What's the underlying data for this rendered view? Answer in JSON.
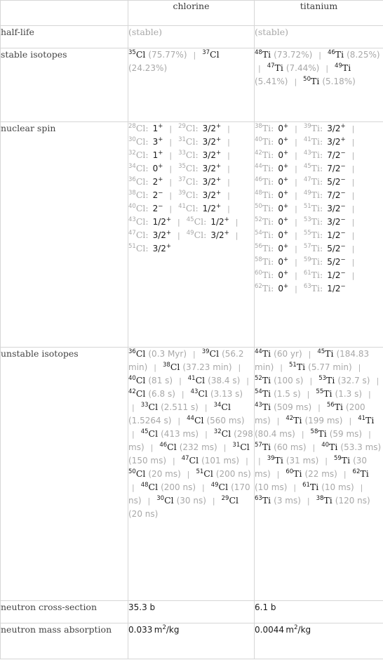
{
  "columns": [
    "",
    "chlorine",
    "titanium"
  ],
  "rows": {
    "half_life": {
      "label": "half-life",
      "chlorine": "(stable)",
      "titanium": "(stable)"
    },
    "stable_isotopes": {
      "label": "stable isotopes",
      "chlorine": [
        {
          "mass": "35",
          "symbol": "Cl",
          "value": "(75.77%)"
        },
        {
          "mass": "37",
          "symbol": "Cl",
          "value": "(24.23%)"
        }
      ],
      "titanium": [
        {
          "mass": "48",
          "symbol": "Ti",
          "value": "(73.72%)"
        },
        {
          "mass": "46",
          "symbol": "Ti",
          "value": "(8.25%)"
        },
        {
          "mass": "47",
          "symbol": "Ti",
          "value": "(7.44%)"
        },
        {
          "mass": "49",
          "symbol": "Ti",
          "value": "(5.41%)"
        },
        {
          "mass": "50",
          "symbol": "Ti",
          "value": "(5.18%)"
        }
      ]
    },
    "nuclear_spin": {
      "label": "nuclear spin",
      "chlorine": [
        {
          "mass": "28",
          "symbol": "Cl:",
          "spin": "1",
          "parity": "+"
        },
        {
          "mass": "29",
          "symbol": "Cl:",
          "spin": "3/2",
          "parity": "+"
        },
        {
          "mass": "30",
          "symbol": "Cl:",
          "spin": "3",
          "parity": "+"
        },
        {
          "mass": "31",
          "symbol": "Cl:",
          "spin": "3/2",
          "parity": "+"
        },
        {
          "mass": "32",
          "symbol": "Cl:",
          "spin": "1",
          "parity": "+"
        },
        {
          "mass": "33",
          "symbol": "Cl:",
          "spin": "3/2",
          "parity": "+"
        },
        {
          "mass": "34",
          "symbol": "Cl:",
          "spin": "0",
          "parity": "+"
        },
        {
          "mass": "35",
          "symbol": "Cl:",
          "spin": "3/2",
          "parity": "+"
        },
        {
          "mass": "36",
          "symbol": "Cl:",
          "spin": "2",
          "parity": "+"
        },
        {
          "mass": "37",
          "symbol": "Cl:",
          "spin": "3/2",
          "parity": "+"
        },
        {
          "mass": "38",
          "symbol": "Cl:",
          "spin": "2",
          "parity": "−"
        },
        {
          "mass": "39",
          "symbol": "Cl:",
          "spin": "3/2",
          "parity": "+"
        },
        {
          "mass": "40",
          "symbol": "Cl:",
          "spin": "2",
          "parity": "−"
        },
        {
          "mass": "41",
          "symbol": "Cl:",
          "spin": "1/2",
          "parity": "+"
        },
        {
          "mass": "43",
          "symbol": "Cl:",
          "spin": "1/2",
          "parity": "+"
        },
        {
          "mass": "45",
          "symbol": "Cl:",
          "spin": "1/2",
          "parity": "+"
        },
        {
          "mass": "47",
          "symbol": "Cl:",
          "spin": "3/2",
          "parity": "+"
        },
        {
          "mass": "49",
          "symbol": "Cl:",
          "spin": "3/2",
          "parity": "+"
        },
        {
          "mass": "51",
          "symbol": "Cl:",
          "spin": "3/2",
          "parity": "+"
        }
      ],
      "titanium": [
        {
          "mass": "38",
          "symbol": "Ti:",
          "spin": "0",
          "parity": "+"
        },
        {
          "mass": "39",
          "symbol": "Ti:",
          "spin": "3/2",
          "parity": "+"
        },
        {
          "mass": "40",
          "symbol": "Ti:",
          "spin": "0",
          "parity": "+"
        },
        {
          "mass": "41",
          "symbol": "Ti:",
          "spin": "3/2",
          "parity": "+"
        },
        {
          "mass": "42",
          "symbol": "Ti:",
          "spin": "0",
          "parity": "+"
        },
        {
          "mass": "43",
          "symbol": "Ti:",
          "spin": "7/2",
          "parity": "−"
        },
        {
          "mass": "44",
          "symbol": "Ti:",
          "spin": "0",
          "parity": "+"
        },
        {
          "mass": "45",
          "symbol": "Ti:",
          "spin": "7/2",
          "parity": "−"
        },
        {
          "mass": "46",
          "symbol": "Ti:",
          "spin": "0",
          "parity": "+"
        },
        {
          "mass": "47",
          "symbol": "Ti:",
          "spin": "5/2",
          "parity": "−"
        },
        {
          "mass": "48",
          "symbol": "Ti:",
          "spin": "0",
          "parity": "+"
        },
        {
          "mass": "49",
          "symbol": "Ti:",
          "spin": "7/2",
          "parity": "−"
        },
        {
          "mass": "50",
          "symbol": "Ti:",
          "spin": "0",
          "parity": "+"
        },
        {
          "mass": "51",
          "symbol": "Ti:",
          "spin": "3/2",
          "parity": "−"
        },
        {
          "mass": "52",
          "symbol": "Ti:",
          "spin": "0",
          "parity": "+"
        },
        {
          "mass": "53",
          "symbol": "Ti:",
          "spin": "3/2",
          "parity": "−"
        },
        {
          "mass": "54",
          "symbol": "Ti:",
          "spin": "0",
          "parity": "+"
        },
        {
          "mass": "55",
          "symbol": "Ti:",
          "spin": "1/2",
          "parity": "−"
        },
        {
          "mass": "56",
          "symbol": "Ti:",
          "spin": "0",
          "parity": "+"
        },
        {
          "mass": "57",
          "symbol": "Ti:",
          "spin": "5/2",
          "parity": "−"
        },
        {
          "mass": "58",
          "symbol": "Ti:",
          "spin": "0",
          "parity": "+"
        },
        {
          "mass": "59",
          "symbol": "Ti:",
          "spin": "5/2",
          "parity": "−"
        },
        {
          "mass": "60",
          "symbol": "Ti:",
          "spin": "0",
          "parity": "+"
        },
        {
          "mass": "61",
          "symbol": "Ti:",
          "spin": "1/2",
          "parity": "−"
        },
        {
          "mass": "62",
          "symbol": "Ti:",
          "spin": "0",
          "parity": "+"
        },
        {
          "mass": "63",
          "symbol": "Ti:",
          "spin": "1/2",
          "parity": "−"
        }
      ]
    },
    "unstable_isotopes": {
      "label": "unstable isotopes",
      "chlorine": [
        {
          "mass": "36",
          "symbol": "Cl",
          "value": "(0.3 Myr)"
        },
        {
          "mass": "39",
          "symbol": "Cl",
          "value": "(56.2 min)"
        },
        {
          "mass": "38",
          "symbol": "Cl",
          "value": "(37.23 min)"
        },
        {
          "mass": "40",
          "symbol": "Cl",
          "value": "(81 s)"
        },
        {
          "mass": "41",
          "symbol": "Cl",
          "value": "(38.4 s)"
        },
        {
          "mass": "42",
          "symbol": "Cl",
          "value": "(6.8 s)"
        },
        {
          "mass": "43",
          "symbol": "Cl",
          "value": "(3.13 s)"
        },
        {
          "mass": "33",
          "symbol": "Cl",
          "value": "(2.511 s)"
        },
        {
          "mass": "34",
          "symbol": "Cl",
          "value": "(1.5264 s)"
        },
        {
          "mass": "44",
          "symbol": "Cl",
          "value": "(560 ms)"
        },
        {
          "mass": "45",
          "symbol": "Cl",
          "value": "(413 ms)"
        },
        {
          "mass": "32",
          "symbol": "Cl",
          "value": "(298 ms)"
        },
        {
          "mass": "46",
          "symbol": "Cl",
          "value": "(232 ms)"
        },
        {
          "mass": "31",
          "symbol": "Cl",
          "value": "(150 ms)"
        },
        {
          "mass": "47",
          "symbol": "Cl",
          "value": "(101 ms)"
        },
        {
          "mass": "50",
          "symbol": "Cl",
          "value": "(20 ms)"
        },
        {
          "mass": "51",
          "symbol": "Cl",
          "value": "(200 ns)"
        },
        {
          "mass": "48",
          "symbol": "Cl",
          "value": "(200 ns)"
        },
        {
          "mass": "49",
          "symbol": "Cl",
          "value": "(170 ns)"
        },
        {
          "mass": "30",
          "symbol": "Cl",
          "value": "(30 ns)"
        },
        {
          "mass": "29",
          "symbol": "Cl",
          "value": "(20 ns)"
        }
      ],
      "titanium": [
        {
          "mass": "44",
          "symbol": "Ti",
          "value": "(60 yr)"
        },
        {
          "mass": "45",
          "symbol": "Ti",
          "value": "(184.83 min)"
        },
        {
          "mass": "51",
          "symbol": "Ti",
          "value": "(5.77 min)"
        },
        {
          "mass": "52",
          "symbol": "Ti",
          "value": "(100 s)"
        },
        {
          "mass": "53",
          "symbol": "Ti",
          "value": "(32.7 s)"
        },
        {
          "mass": "54",
          "symbol": "Ti",
          "value": "(1.5 s)"
        },
        {
          "mass": "55",
          "symbol": "Ti",
          "value": "(1.3 s)"
        },
        {
          "mass": "43",
          "symbol": "Ti",
          "value": "(509 ms)"
        },
        {
          "mass": "56",
          "symbol": "Ti",
          "value": "(200 ms)"
        },
        {
          "mass": "42",
          "symbol": "Ti",
          "value": "(199 ms)"
        },
        {
          "mass": "41",
          "symbol": "Ti",
          "value": "(80.4 ms)"
        },
        {
          "mass": "58",
          "symbol": "Ti",
          "value": "(59 ms)"
        },
        {
          "mass": "57",
          "symbol": "Ti",
          "value": "(60 ms)"
        },
        {
          "mass": "40",
          "symbol": "Ti",
          "value": "(53.3 ms)"
        },
        {
          "mass": "39",
          "symbol": "Ti",
          "value": "(31 ms)"
        },
        {
          "mass": "59",
          "symbol": "Ti",
          "value": "(30 ms)"
        },
        {
          "mass": "60",
          "symbol": "Ti",
          "value": "(22 ms)"
        },
        {
          "mass": "62",
          "symbol": "Ti",
          "value": "(10 ms)"
        },
        {
          "mass": "61",
          "symbol": "Ti",
          "value": "(10 ms)"
        },
        {
          "mass": "63",
          "symbol": "Ti",
          "value": "(3 ms)"
        },
        {
          "mass": "38",
          "symbol": "Ti",
          "value": "(120 ns)"
        }
      ]
    },
    "neutron_cross_section": {
      "label": "neutron cross-section",
      "chlorine": "35.3 b",
      "titanium": "6.1 b"
    },
    "neutron_mass_absorption": {
      "label": "neutron mass absorption",
      "chlorine": {
        "number": "0.033",
        "unit": "m",
        "exp": "2",
        "rest": "/kg"
      },
      "titanium": {
        "number": "0.0044",
        "unit": "m",
        "exp": "2",
        "rest": "/kg"
      }
    },
    "separator": "|"
  }
}
